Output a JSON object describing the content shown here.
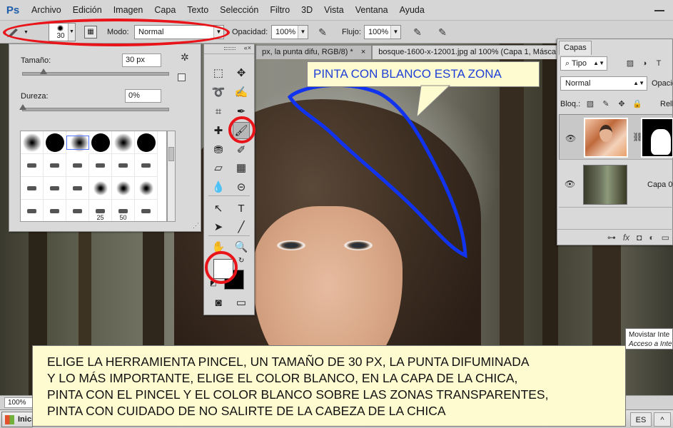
{
  "app": {
    "logo": "Ps",
    "menu": [
      "Archivo",
      "Edición",
      "Imagen",
      "Capa",
      "Texto",
      "Selección",
      "Filtro",
      "3D",
      "Vista",
      "Ventana",
      "Ayuda"
    ]
  },
  "options": {
    "brush_size": "30",
    "mode_label": "Modo:",
    "mode_value": "Normal",
    "opacity_label": "Opacidad:",
    "opacity_value": "100%",
    "flow_label": "Flujo:",
    "flow_value": "100%"
  },
  "doc_tabs": [
    {
      "label": "px, la punta difu, RGB/8) *",
      "close": "×"
    },
    {
      "label": "bosque-1600-x-12001.jpg al 100% (Capa 1, Másca",
      "close": ""
    }
  ],
  "brush_panel": {
    "size_label": "Tamaño:",
    "size_value": "30 px",
    "size_level": 0.15,
    "hardness_label": "Dureza:",
    "hardness_value": "0%",
    "hardness_level": 0.0,
    "preset_numbers": [
      "25",
      "50"
    ]
  },
  "callout": {
    "text": "PINTA CON BLANCO ESTA ZONA"
  },
  "layers": {
    "tab": "Capas",
    "filter": "Tipo",
    "blend": "Normal",
    "opacity_label": "Opacid",
    "lock_label": "Bloq.:",
    "fill_label": "Relle",
    "layer_bottom": "Capa 0"
  },
  "tooltip": {
    "line1": "Movistar Inte",
    "line2": "Acceso a Inte"
  },
  "instructions": [
    "ELIGE LA HERRAMIENTA PINCEL, UN TAMAÑO DE 30 PX, LA PUNTA DIFUMINADA",
    "Y LO MÁS IMPORTANTE,  ELIGE EL COLOR BLANCO, EN LA CAPA DE LA CHICA,",
    "PINTA CON EL PINCEL  Y EL COLOR BLANCO SOBRE LAS ZONAS TRANSPARENTES,",
    "PINTA CON CUIDADO DE NO SALIRTE DE LA CABEZA DE LA CHICA"
  ],
  "status": {
    "zoom": "100%"
  },
  "taskbar": {
    "start": "Inici",
    "lang": "ES",
    "tray": "^"
  },
  "colors": {
    "annotation_red": "#e8141a",
    "outline_blue": "#1133ee",
    "callout_text": "#1e3fd6",
    "note_bg": "#fffbd0",
    "foreground": "#ffffff",
    "background": "#000000"
  }
}
